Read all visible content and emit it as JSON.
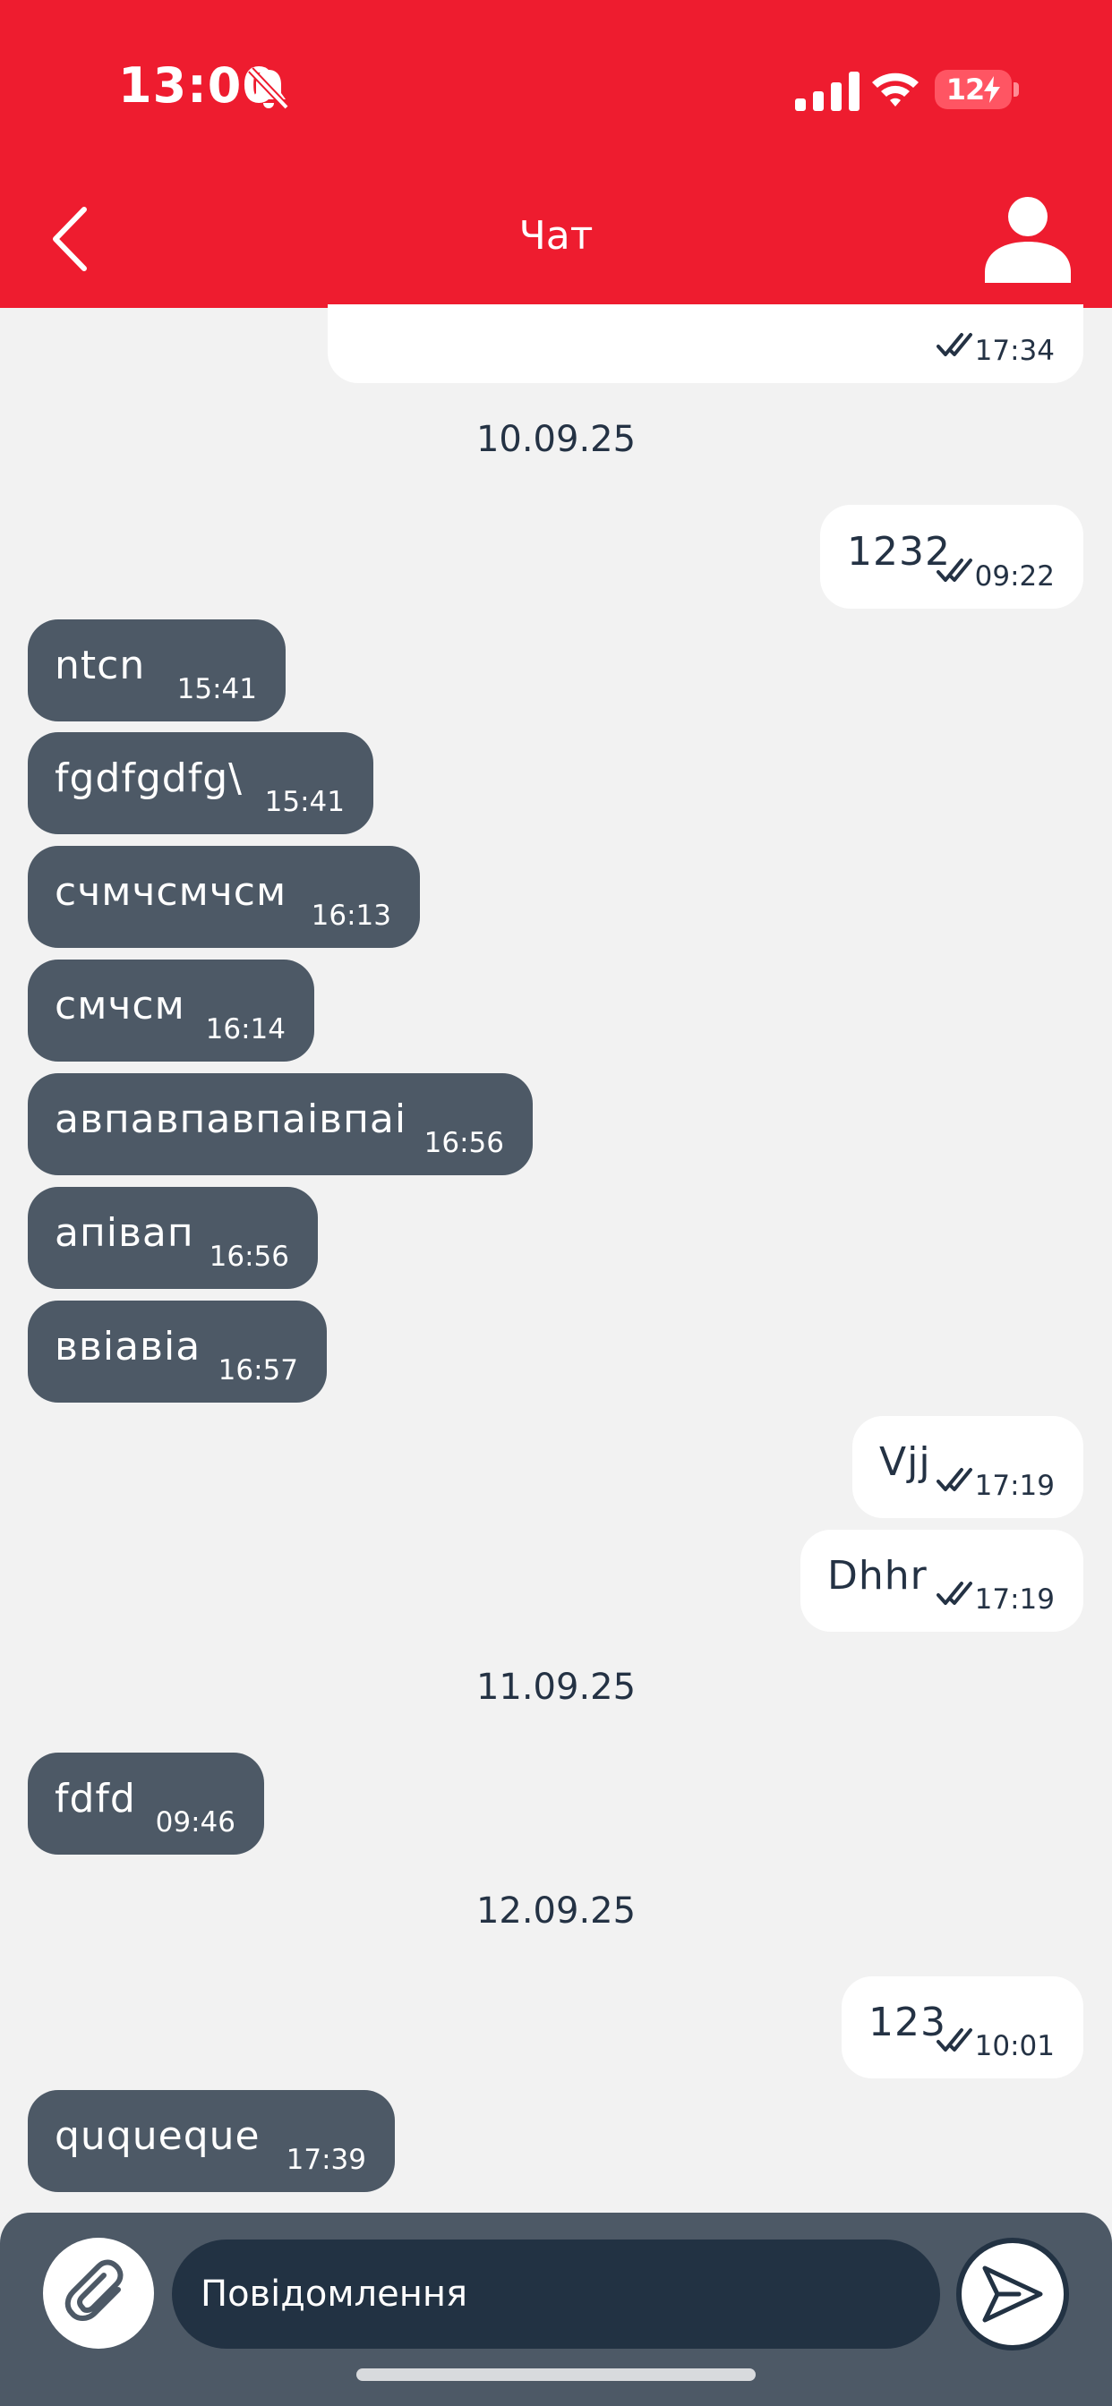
{
  "status_bar": {
    "time": "13:00",
    "battery": "12"
  },
  "header": {
    "title": "Чат"
  },
  "messages": [
    {
      "dir": "out",
      "text": "",
      "time": "17:34",
      "read": true
    },
    {
      "dir": "date",
      "text": "10.09.25"
    },
    {
      "dir": "out",
      "text": "1232",
      "time": "09:22",
      "read": true
    },
    {
      "dir": "in",
      "text": "ntcn",
      "time": "15:41"
    },
    {
      "dir": "in",
      "text": "fgdfgdfg\\",
      "time": "15:41"
    },
    {
      "dir": "in",
      "text": "счмчсмчсм",
      "time": "16:13"
    },
    {
      "dir": "in",
      "text": "смчсм",
      "time": "16:14"
    },
    {
      "dir": "in",
      "text": "авпавпавпаівпаі",
      "time": "16:56"
    },
    {
      "dir": "in",
      "text": "апівап",
      "time": "16:56"
    },
    {
      "dir": "in",
      "text": "ввіавіа",
      "time": "16:57"
    },
    {
      "dir": "out",
      "text": "Vjj",
      "time": "17:19",
      "read": true
    },
    {
      "dir": "out",
      "text": "Dhhr",
      "time": "17:19",
      "read": true
    },
    {
      "dir": "date",
      "text": "11.09.25"
    },
    {
      "dir": "in",
      "text": "fdfd",
      "time": "09:46"
    },
    {
      "dir": "date",
      "text": "12.09.25"
    },
    {
      "dir": "out",
      "text": "123",
      "time": "10:01",
      "read": true
    },
    {
      "dir": "in",
      "text": "ququeque",
      "time": "17:39"
    }
  ],
  "composer": {
    "placeholder": "Повідомлення"
  },
  "icons": {
    "back": "chevron-left-icon",
    "profile": "user-icon",
    "attach": "paperclip-icon",
    "send": "send-icon",
    "read_receipt": "double-check-icon"
  },
  "colors": {
    "header": "#ee1c2f",
    "incoming_bubble": "#4d5966",
    "outgoing_bubble": "#ffffff",
    "input": "#223243"
  }
}
